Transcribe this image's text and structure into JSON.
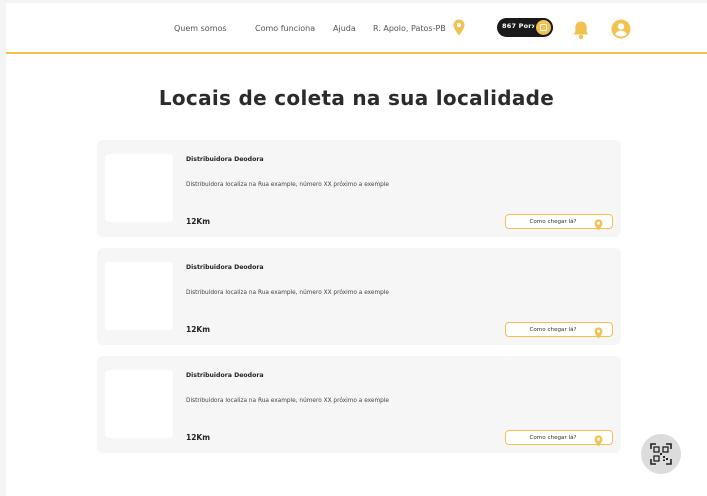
{
  "header": {
    "nav": [
      "Quem somos",
      "Como funciona",
      "Ajuda"
    ],
    "location": "R. Apolo, Patos-PB",
    "points_label": "867 Porx",
    "accent_color": "#f2c14e",
    "icons": [
      "location-pin-icon",
      "wallet-icon",
      "bell-icon",
      "user-avatar-icon"
    ]
  },
  "main": {
    "title": "Locais de coleta na sua localidade",
    "locations": [
      {
        "name": "Distribuidora Deodora",
        "description": "Distribuidora localiza na Rua example, número XX próximo a exemple",
        "distance": "12Km",
        "button_label": "Como chegar lá?"
      },
      {
        "name": "Distribuidora Deodora",
        "description": "Distribuidora localiza na Rua example, número XX próximo a exemple",
        "distance": "12Km",
        "button_label": "Como chegar lá?"
      },
      {
        "name": "Distribuidora Deodora",
        "description": "Distribuidora localiza na Rua example, número XX próximo a exemple",
        "distance": "12Km",
        "button_label": "Como chegar lá?"
      }
    ]
  },
  "fab": {
    "icon": "qr-code-icon"
  }
}
